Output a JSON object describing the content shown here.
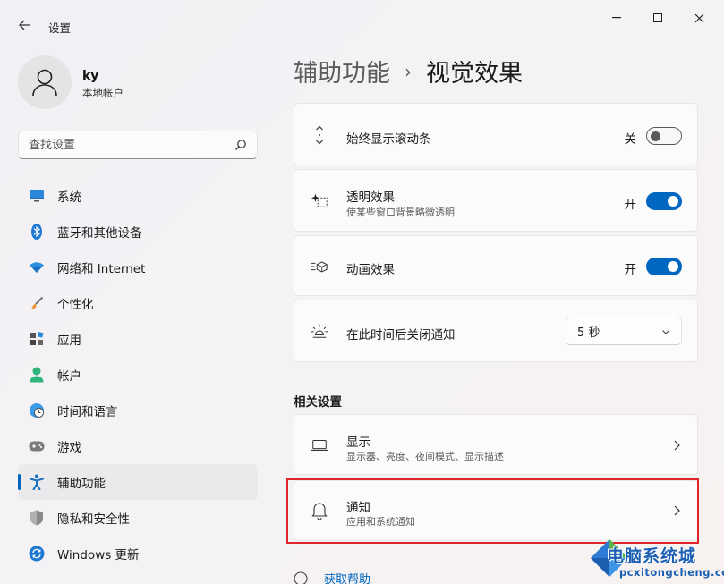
{
  "window": {
    "title": "设置",
    "icons": {
      "back": "arrow-left-icon",
      "minimize": "minimize-icon",
      "maximize": "maximize-icon",
      "close": "close-icon"
    }
  },
  "user": {
    "name": "ky",
    "account_type": "本地帐户"
  },
  "search": {
    "placeholder": "查找设置"
  },
  "sidebar": {
    "items": [
      {
        "label": "系统",
        "icon": "monitor-icon"
      },
      {
        "label": "蓝牙和其他设备",
        "icon": "bluetooth-icon"
      },
      {
        "label": "网络和 Internet",
        "icon": "wifi-icon"
      },
      {
        "label": "个性化",
        "icon": "brush-icon"
      },
      {
        "label": "应用",
        "icon": "apps-icon"
      },
      {
        "label": "帐户",
        "icon": "person-icon"
      },
      {
        "label": "时间和语言",
        "icon": "clock-globe-icon"
      },
      {
        "label": "游戏",
        "icon": "gamepad-icon"
      },
      {
        "label": "辅助功能",
        "icon": "accessibility-icon",
        "active": true
      },
      {
        "label": "隐私和安全性",
        "icon": "shield-icon"
      },
      {
        "label": "Windows 更新",
        "icon": "update-icon"
      }
    ]
  },
  "breadcrumb": {
    "parent": "辅助功能",
    "separator": "›",
    "current": "视觉效果"
  },
  "settings": {
    "scrollbars": {
      "title": "始终显示滚动条",
      "state_label": "关",
      "on": false,
      "icon": "scroll-arrows-icon"
    },
    "transparency": {
      "title": "透明效果",
      "subtitle": "使某些窗口背景略微透明",
      "state_label": "开",
      "on": true,
      "icon": "sparkle-icon"
    },
    "animation": {
      "title": "动画效果",
      "state_label": "开",
      "on": true,
      "icon": "animation-icon"
    },
    "notify_timeout": {
      "title": "在此时间后关闭通知",
      "value": "5 秒",
      "icon": "brightness-icon"
    }
  },
  "related": {
    "title": "相关设置",
    "display": {
      "title": "显示",
      "subtitle": "显示器、亮度、夜间模式、显示描述",
      "icon": "laptop-icon"
    },
    "notifications": {
      "title": "通知",
      "subtitle": "应用和系统通知",
      "icon": "bell-icon"
    }
  },
  "help": {
    "label": "获取帮助"
  },
  "watermark": {
    "text": "电脑系统城",
    "url": "pcxitongcheng.com"
  },
  "colors": {
    "accent": "#0067c0",
    "highlight": "#e0242a"
  }
}
